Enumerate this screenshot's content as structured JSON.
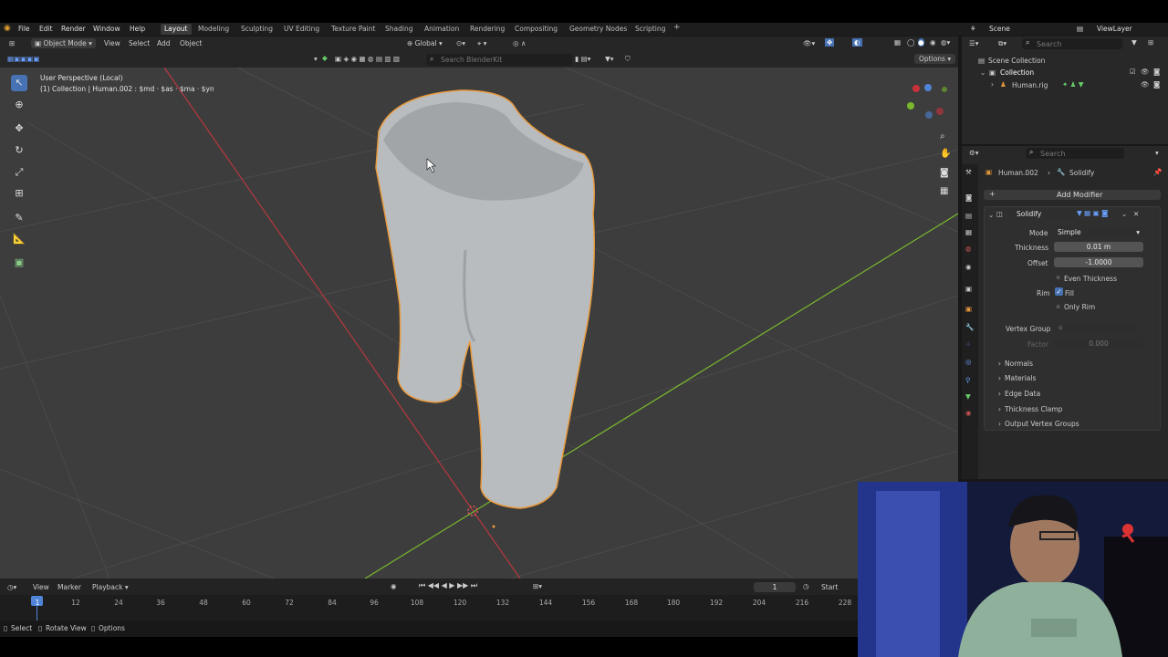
{
  "menu": {
    "file": "File",
    "edit": "Edit",
    "render": "Render",
    "window": "Window",
    "help": "Help"
  },
  "workspaces": [
    "Layout",
    "Modeling",
    "Sculpting",
    "UV Editing",
    "Texture Paint",
    "Shading",
    "Animation",
    "Rendering",
    "Compositing",
    "Geometry Nodes",
    "Scripting"
  ],
  "workspace_add": "+",
  "scene": {
    "label": "Scene",
    "viewlayer": "ViewLayer"
  },
  "header": {
    "mode": "Object Mode",
    "view": "View",
    "select": "Select",
    "add": "Add",
    "object": "Object",
    "transform": "Global",
    "options": "Options"
  },
  "search_placeholder": "Search BlenderKit",
  "viewport": {
    "perspective": "User Perspective (Local)",
    "info": "(1) Collection | Human.002 : $md · $as · $ma · $yn"
  },
  "outliner": {
    "search_placeholder": "Search",
    "scene_collection": "Scene Collection",
    "collection": "Collection",
    "rig": "Human.rig"
  },
  "properties": {
    "search_placeholder": "Search",
    "breadcrumb_object": "Human.002",
    "breadcrumb_sep": "›",
    "breadcrumb_modifier": "Solidify",
    "add_modifier": "Add Modifier",
    "modifier_name": "Solidify",
    "mode_label": "Mode",
    "mode_value": "Simple",
    "thickness_label": "Thickness",
    "thickness_value": "0.01 m",
    "offset_label": "Offset",
    "offset_value": "-1.0000",
    "even_thickness": "Even Thickness",
    "rim_label": "Rim",
    "fill": "Fill",
    "fill_checked": true,
    "only_rim": "Only Rim",
    "vertex_group_label": "Vertex Group",
    "factor_label": "Factor",
    "factor_value": "0.000",
    "panels": [
      "Normals",
      "Materials",
      "Edge Data",
      "Thickness Clamp",
      "Output Vertex Groups"
    ]
  },
  "timeline": {
    "view": "View",
    "marker": "Marker",
    "playback": "Playback",
    "current_frame": "1",
    "start": "Start",
    "ticks": [
      "1",
      "12",
      "24",
      "36",
      "48",
      "60",
      "72",
      "84",
      "96",
      "108",
      "120",
      "132",
      "144",
      "156",
      "168",
      "180",
      "192",
      "204",
      "216",
      "228"
    ]
  },
  "status": {
    "select": "Select",
    "rotate": "Rotate View",
    "options": "Options"
  },
  "colors": {
    "accent": "#4772b3",
    "selection": "#e89a3c",
    "x_axis": "#c8303a",
    "y_axis": "#7ab82d",
    "active_frame": "#4f84d6"
  }
}
